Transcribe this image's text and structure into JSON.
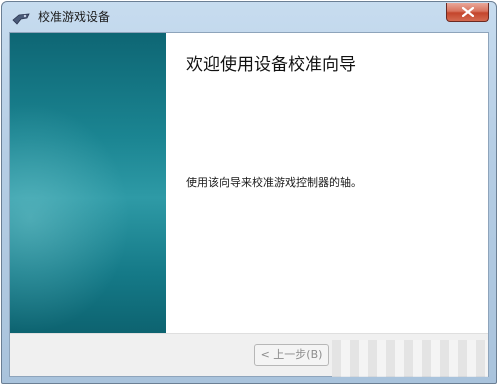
{
  "window": {
    "title": "校准游戏设备",
    "title_icon": "game-controller-icon",
    "close_icon": "close-icon"
  },
  "wizard": {
    "heading": "欢迎使用设备校准向导",
    "description": "使用该向导来校准游戏控制器的轴。"
  },
  "buttons": {
    "back_label": "< 上一步(B)"
  },
  "colors": {
    "side_panel": "#1b8592",
    "close_button": "#c4452c",
    "frame": "#b5cde4"
  }
}
